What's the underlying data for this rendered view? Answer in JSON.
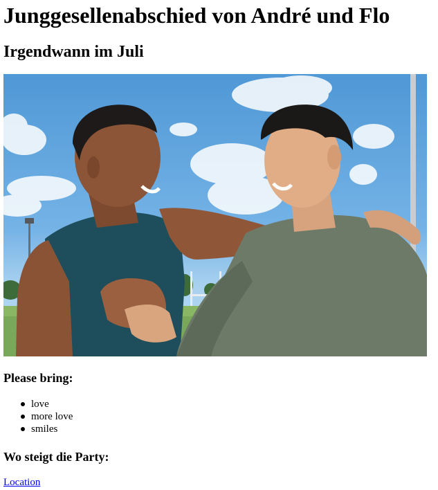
{
  "header": {
    "title": "Junggesellenabschied von André und Flo",
    "subtitle": "Irgendwann im Juli"
  },
  "photo": {
    "description": "two smiling men shaking hands"
  },
  "bring": {
    "heading": "Please bring:",
    "items": [
      "love",
      "more love",
      "smiles"
    ]
  },
  "party": {
    "heading": "Wo steigt die Party:",
    "link_label": "Location"
  }
}
